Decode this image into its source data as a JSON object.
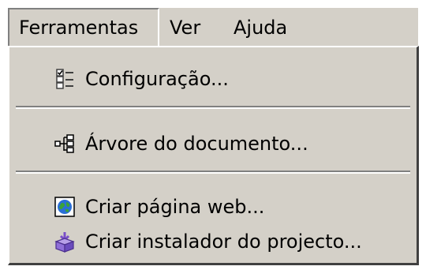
{
  "menubar": {
    "items": [
      {
        "label": "Ferramentas"
      },
      {
        "label": "Ver"
      },
      {
        "label": "Ajuda"
      }
    ]
  },
  "dropdown": {
    "items": [
      {
        "label": "Configuração...",
        "icon": "settings-checklist-icon"
      },
      {
        "label": "Árvore do documento...",
        "icon": "tree-structure-icon"
      },
      {
        "label": "Criar página web...",
        "icon": "web-globe-icon"
      },
      {
        "label": "Criar instalador do projecto...",
        "icon": "installer-package-icon"
      }
    ]
  }
}
